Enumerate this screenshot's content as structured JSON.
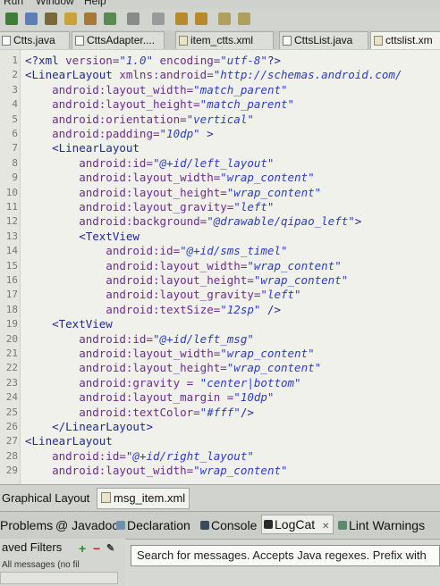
{
  "menu": {
    "items": [
      "Run",
      "Window",
      "Help"
    ]
  },
  "editor_tabs": [
    {
      "label": "Ctts.java",
      "icon": "java-file-icon",
      "active": false
    },
    {
      "label": "CttsAdapter....",
      "icon": "java-file-icon",
      "active": false
    },
    {
      "label": "item_ctts.xml",
      "icon": "xml-file-icon",
      "active": false
    },
    {
      "label": "CttsList.java",
      "icon": "java-file-icon",
      "active": false
    },
    {
      "label": "cttslist.xm",
      "icon": "xml-file-icon",
      "active": true
    }
  ],
  "code_lines": [
    {
      "n": "1",
      "parts": [
        [
          "tag",
          "<?xml "
        ],
        [
          "att",
          "version="
        ],
        [
          "val",
          "\"1.0\""
        ],
        [
          "att",
          " encoding="
        ],
        [
          "val",
          "\"utf-8\""
        ],
        [
          "tag",
          "?>"
        ]
      ]
    },
    {
      "n": "2",
      "parts": [
        [
          "tag",
          "<LinearLayout "
        ],
        [
          "att",
          "xmlns:android="
        ],
        [
          "val",
          "\"http://schemas.android.com/"
        ]
      ]
    },
    {
      "n": "3",
      "parts": [
        [
          "att",
          "    android:layout_width="
        ],
        [
          "val",
          "\"match_parent\""
        ]
      ]
    },
    {
      "n": "4",
      "parts": [
        [
          "att",
          "    android:layout_height="
        ],
        [
          "val",
          "\"match_parent\""
        ]
      ]
    },
    {
      "n": "5",
      "parts": [
        [
          "att",
          "    android:orientation="
        ],
        [
          "val",
          "\"vertical\""
        ]
      ]
    },
    {
      "n": "6",
      "parts": [
        [
          "att",
          "    android:padding="
        ],
        [
          "val",
          "\"10dp\""
        ],
        [
          "tag",
          " >"
        ]
      ]
    },
    {
      "n": "7",
      "parts": [
        [
          "tag",
          "    <LinearLayout"
        ]
      ]
    },
    {
      "n": "8",
      "parts": [
        [
          "att",
          "        android:id="
        ],
        [
          "val",
          "\"@+id/left_layout\""
        ]
      ]
    },
    {
      "n": "9",
      "parts": [
        [
          "att",
          "        android:layout_width="
        ],
        [
          "val",
          "\"wrap_content\""
        ]
      ]
    },
    {
      "n": "10",
      "parts": [
        [
          "att",
          "        android:layout_height="
        ],
        [
          "val",
          "\"wrap_content\""
        ]
      ]
    },
    {
      "n": "11",
      "parts": [
        [
          "att",
          "        android:layout_gravity="
        ],
        [
          "val",
          "\"left\""
        ]
      ]
    },
    {
      "n": "12",
      "parts": [
        [
          "att",
          "        android:background="
        ],
        [
          "val",
          "\"@drawable/qipao_left\""
        ],
        [
          "tag",
          ">"
        ]
      ]
    },
    {
      "n": "13",
      "parts": [
        [
          "tag",
          "        <TextView"
        ]
      ]
    },
    {
      "n": "14",
      "parts": [
        [
          "att",
          "            android:id="
        ],
        [
          "val",
          "\"@+id/sms_timel\""
        ]
      ]
    },
    {
      "n": "15",
      "parts": [
        [
          "att",
          "            android:layout_width="
        ],
        [
          "val",
          "\"wrap_content\""
        ]
      ]
    },
    {
      "n": "16",
      "parts": [
        [
          "att",
          "            android:layout_height="
        ],
        [
          "val",
          "\"wrap_content\""
        ]
      ]
    },
    {
      "n": "17",
      "parts": [
        [
          "att",
          "            android:layout_gravity="
        ],
        [
          "val",
          "\"left\""
        ]
      ]
    },
    {
      "n": "18",
      "parts": [
        [
          "att",
          "            android:textSize="
        ],
        [
          "val",
          "\"12sp\""
        ],
        [
          "tag",
          " />"
        ]
      ]
    },
    {
      "n": "19",
      "parts": [
        [
          "tag",
          "    <TextView"
        ]
      ]
    },
    {
      "n": "20",
      "parts": [
        [
          "att",
          "        android:id="
        ],
        [
          "val",
          "\"@+id/left_msg\""
        ]
      ]
    },
    {
      "n": "21",
      "parts": [
        [
          "att",
          "        android:layout_width="
        ],
        [
          "val",
          "\"wrap_content\""
        ]
      ]
    },
    {
      "n": "22",
      "parts": [
        [
          "att",
          "        android:layout_height="
        ],
        [
          "val",
          "\"wrap_content\""
        ]
      ]
    },
    {
      "n": "23",
      "parts": [
        [
          "att",
          "        android:gravity = "
        ],
        [
          "val",
          "\"center|bottom\""
        ]
      ]
    },
    {
      "n": "24",
      "parts": [
        [
          "att",
          "        android:layout_margin ="
        ],
        [
          "val",
          "\"10dp\""
        ]
      ]
    },
    {
      "n": "25",
      "parts": [
        [
          "att",
          "        android:textColor="
        ],
        [
          "val",
          "\"#fff\""
        ],
        [
          "tag",
          "/>"
        ]
      ]
    },
    {
      "n": "26",
      "parts": [
        [
          "tag",
          "    </LinearLayout>"
        ]
      ]
    },
    {
      "n": "27",
      "parts": [
        [
          "tag",
          "<LinearLayout"
        ]
      ]
    },
    {
      "n": "28",
      "parts": [
        [
          "att",
          "    android:id="
        ],
        [
          "val",
          "\"@+id/right_layout\""
        ]
      ]
    },
    {
      "n": "29",
      "parts": [
        [
          "att",
          "    android:layout_width="
        ],
        [
          "val",
          "\"wrap_content\""
        ]
      ]
    }
  ],
  "editor_bottom_tabs": [
    {
      "label": "Graphical Layout",
      "active": false
    },
    {
      "label": "msg_item.xml",
      "active": true
    }
  ],
  "view_tabs": [
    {
      "label": "Problems",
      "icon": "problems-icon",
      "active": false
    },
    {
      "label": "@ Javadoc",
      "icon": "",
      "active": false
    },
    {
      "label": "Declaration",
      "icon": "declaration-icon",
      "active": false
    },
    {
      "label": "Console",
      "icon": "console-icon",
      "active": false
    },
    {
      "label": "LogCat",
      "icon": "logcat-icon",
      "active": true
    },
    {
      "label": "Lint Warnings",
      "icon": "lint-icon",
      "active": false
    }
  ],
  "filters": {
    "title": "aved Filters",
    "sub": "All messages (no fil"
  },
  "search": {
    "placeholder": "Search for messages. Accepts Java regexes. Prefix with"
  },
  "colors": {
    "tag": "#1f2a8c",
    "attr": "#6b2c8f",
    "value": "#2a3cc8",
    "editor_bg": "#f1f1ec"
  }
}
